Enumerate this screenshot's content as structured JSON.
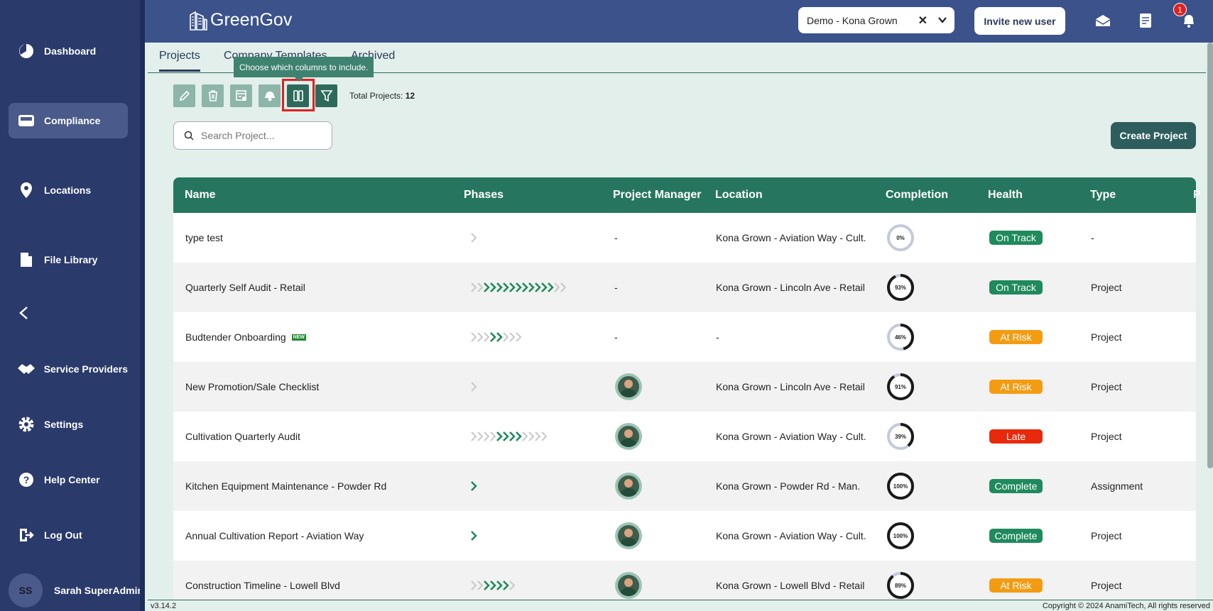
{
  "brand": {
    "name": "GreenGov"
  },
  "sidebar": {
    "items": [
      {
        "label": "Dashboard",
        "icon": "dashboard-icon"
      },
      {
        "label": "Compliance",
        "icon": "compliance-icon",
        "active": true
      },
      {
        "label": "Locations",
        "icon": "location-pin-icon"
      },
      {
        "label": "File Library",
        "icon": "file-icon"
      },
      {
        "label": "Service Providers",
        "icon": "handshake-icon"
      },
      {
        "label": "Settings",
        "icon": "gear-icon"
      },
      {
        "label": "Help Center",
        "icon": "help-icon"
      },
      {
        "label": "Log Out",
        "icon": "logout-icon"
      }
    ],
    "user": {
      "initials": "SS",
      "name": "Sarah SuperAdmin"
    }
  },
  "header": {
    "org_select": "Demo - Kona Grown",
    "invite_label": "Invite new user",
    "notification_count": "1"
  },
  "tabs": [
    {
      "label": "Projects",
      "active": true
    },
    {
      "label": "Company Templates"
    },
    {
      "label": "Archived"
    }
  ],
  "toolbar": {
    "tooltip": "Choose which columns to include.",
    "total_label": "Total Projects:",
    "total_value": "12"
  },
  "search": {
    "placeholder": "Search Project..."
  },
  "create_label": "Create Project",
  "table": {
    "columns": [
      "Name",
      "Phases",
      "Project Manager",
      "Location",
      "Completion",
      "Health",
      "Type",
      "P"
    ],
    "rows": [
      {
        "name": "type test",
        "new": false,
        "phases": {
          "total": 1,
          "done": 0
        },
        "pm": "-",
        "location": "Kona Grown - Aviation Way - Cult.",
        "completion": 0,
        "completion_label": "0%",
        "health": "On Track",
        "type": "-"
      },
      {
        "name": "Quarterly Self Audit - Retail",
        "new": false,
        "phases": {
          "total": 15,
          "done": 11
        },
        "pm": "-",
        "location": "Kona Grown - Lincoln Ave - Retail",
        "completion": 93,
        "completion_label": "93%",
        "health": "On Track",
        "type": "Project"
      },
      {
        "name": "Budtender Onboarding",
        "new": true,
        "new_label": "NEW",
        "phases": {
          "total": 8,
          "done": 2
        },
        "pm": "-",
        "location": "-",
        "completion": 46,
        "completion_label": "46%",
        "health": "At Risk",
        "type": "Project"
      },
      {
        "name": "New Promotion/Sale Checklist",
        "new": false,
        "phases": {
          "total": 1,
          "done": 0
        },
        "pm": "avatar",
        "location": "Kona Grown - Lincoln Ave - Retail",
        "completion": 91,
        "completion_label": "91%",
        "health": "At Risk",
        "type": "Project"
      },
      {
        "name": "Cultivation Quarterly Audit",
        "new": false,
        "phases": {
          "total": 12,
          "done": 4
        },
        "pm": "avatar",
        "location": "Kona Grown - Aviation Way - Cult.",
        "completion": 39,
        "completion_label": "39%",
        "health": "Late",
        "type": "Project"
      },
      {
        "name": "Kitchen Equipment Maintenance - Powder Rd",
        "new": false,
        "phases": {
          "total": 1,
          "done": 1
        },
        "pm": "avatar",
        "location": "Kona Grown - Powder Rd - Man.",
        "completion": 100,
        "completion_label": "100%",
        "health": "Complete",
        "type": "Assignment"
      },
      {
        "name": "Annual Cultivation Report - Aviation Way",
        "new": false,
        "phases": {
          "total": 1,
          "done": 1
        },
        "pm": "avatar",
        "location": "Kona Grown - Aviation Way - Cult.",
        "completion": 100,
        "completion_label": "100%",
        "health": "Complete",
        "type": "Project"
      },
      {
        "name": "Construction Timeline - Lowell Blvd",
        "new": false,
        "phases": {
          "total": 7,
          "done": 4
        },
        "pm": "avatar",
        "location": "Kona Grown - Lowell Blvd - Retail",
        "completion": 89,
        "completion_label": "89%",
        "health": "At Risk",
        "type": "Project"
      }
    ]
  },
  "colors": {
    "sidebar": "#2a3a6b",
    "topbar": "#3b528b",
    "table_header": "#26765f",
    "on_track": "#1f8a5c",
    "at_risk": "#f39c12",
    "late": "#e8290b",
    "complete": "#1f8a5c",
    "phase_done": "#1f8a5c",
    "phase_todo": "#c8c8c8"
  },
  "footer": {
    "version": "v3.14.2",
    "copyright": "Copyright © 2024 AnamiTech, All rights reserved"
  }
}
